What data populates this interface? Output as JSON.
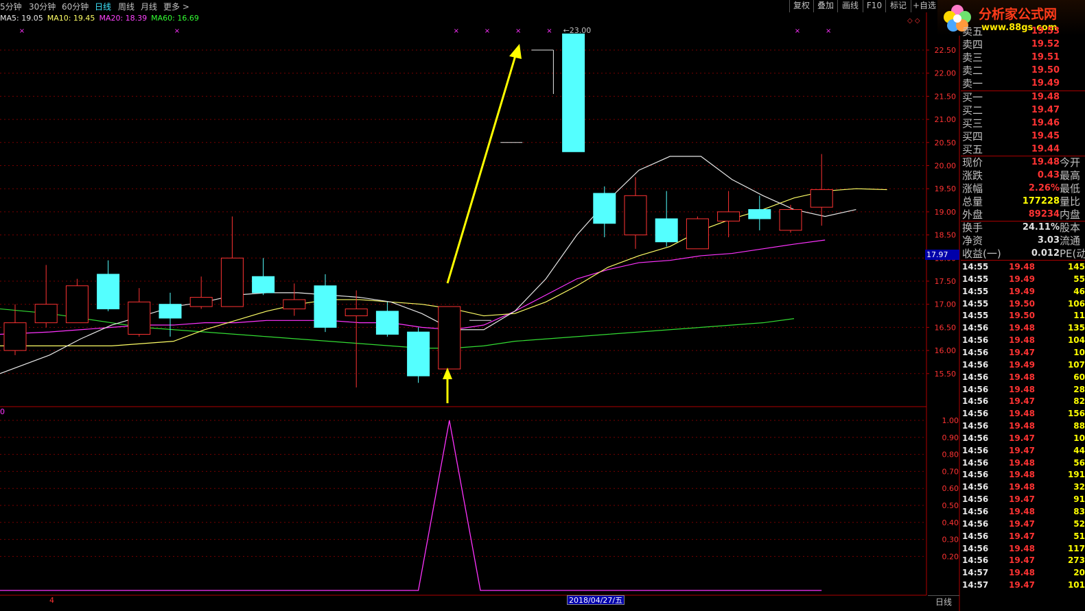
{
  "toolbar": {
    "periods": [
      {
        "label": "5分钟",
        "active": false
      },
      {
        "label": "30分钟",
        "active": false
      },
      {
        "label": "60分钟",
        "active": false
      },
      {
        "label": "日线",
        "active": true
      },
      {
        "label": "周线",
        "active": false
      },
      {
        "label": "月线",
        "active": false
      },
      {
        "label": "更多 >",
        "active": false
      }
    ],
    "buttons": [
      "复权",
      "叠加",
      "画线",
      "F10",
      "标记",
      "+自选"
    ]
  },
  "logo": {
    "title": "分析家公式网",
    "url": "www.88gs.com"
  },
  "ma_legend": [
    {
      "label": "MA5: 19.05",
      "color": "#e8e8e8"
    },
    {
      "label": "MA10: 19.45",
      "color": "#ffff66"
    },
    {
      "label": "MA20: 18.39",
      "color": "#ff44ff"
    },
    {
      "label": "MA60: 16.69",
      "color": "#33ff33"
    }
  ],
  "chart_data": {
    "type": "candlestick",
    "price_axis": {
      "min": 15.0,
      "max": 23.0,
      "ticks": [
        "22.50",
        "22.00",
        "21.50",
        "21.00",
        "20.50",
        "20.00",
        "19.50",
        "19.00",
        "18.50",
        "18.00",
        "17.50",
        "17.00",
        "16.50",
        "16.00",
        "15.50"
      ]
    },
    "indicator_axis": {
      "min": 0,
      "max": 1.0,
      "ticks": [
        "1.00",
        "0.90",
        "0.80",
        "0.70",
        "0.60",
        "0.50",
        "0.40",
        "0.30",
        "0.20"
      ]
    },
    "high_marker": "23.00",
    "current_price_tag": "17.97",
    "candles": [
      {
        "o": 16.0,
        "c": 16.6,
        "h": 17.0,
        "l": 15.9
      },
      {
        "o": 16.6,
        "c": 17.0,
        "h": 17.85,
        "l": 16.5
      },
      {
        "o": 16.6,
        "c": 17.4,
        "h": 17.55,
        "l": 16.6
      },
      {
        "o": 17.65,
        "c": 16.9,
        "h": 17.95,
        "l": 16.85
      },
      {
        "o": 16.35,
        "c": 17.05,
        "h": 17.35,
        "l": 16.3
      },
      {
        "o": 17.0,
        "c": 16.7,
        "h": 17.25,
        "l": 16.3
      },
      {
        "o": 16.95,
        "c": 17.15,
        "h": 17.6,
        "l": 16.9
      },
      {
        "o": 16.95,
        "c": 18.0,
        "h": 18.9,
        "l": 16.95
      },
      {
        "o": 17.6,
        "c": 17.25,
        "h": 18.0,
        "l": 17.2
      },
      {
        "o": 16.9,
        "c": 17.1,
        "h": 17.45,
        "l": 16.75
      },
      {
        "o": 17.4,
        "c": 16.5,
        "h": 17.65,
        "l": 16.4
      },
      {
        "o": 16.75,
        "c": 16.9,
        "h": 17.3,
        "l": 15.2
      },
      {
        "o": 16.85,
        "c": 16.35,
        "h": 17.05,
        "l": 16.3
      },
      {
        "o": 16.4,
        "c": 15.45,
        "h": 16.5,
        "l": 15.3
      },
      {
        "o": 15.6,
        "c": 16.95,
        "h": 16.95,
        "l": 15.6
      },
      {
        "o": 16.65,
        "c": 16.65,
        "h": 16.65,
        "l": 16.65,
        "doji": true
      },
      {
        "o": 20.5,
        "c": 20.5,
        "h": 20.5,
        "l": 20.5,
        "doji": true
      },
      {
        "o": 22.5,
        "c": 22.5,
        "h": 22.5,
        "l": 21.55,
        "doji": true
      },
      {
        "o": 22.85,
        "c": 20.3,
        "h": 22.85,
        "l": 20.3
      },
      {
        "o": 19.4,
        "c": 18.75,
        "h": 19.55,
        "l": 18.45
      },
      {
        "o": 18.5,
        "c": 19.35,
        "h": 19.75,
        "l": 18.2
      },
      {
        "o": 18.85,
        "c": 18.35,
        "h": 19.45,
        "l": 18.25
      },
      {
        "o": 18.2,
        "c": 18.85,
        "h": 18.9,
        "l": 18.2
      },
      {
        "o": 18.8,
        "c": 19.0,
        "h": 19.45,
        "l": 18.45
      },
      {
        "o": 19.05,
        "c": 18.85,
        "h": 19.35,
        "l": 18.6
      },
      {
        "o": 18.6,
        "c": 19.05,
        "h": 19.15,
        "l": 18.55
      },
      {
        "o": 19.1,
        "c": 19.48,
        "h": 20.25,
        "l": 18.7
      }
    ],
    "ma5": [
      15.5,
      15.9,
      16.25,
      16.55,
      16.75,
      16.95,
      17.05,
      17.2,
      17.25,
      17.25,
      17.2,
      17.15,
      17.05,
      16.8,
      16.45,
      16.45,
      16.85,
      17.55,
      18.5,
      19.25,
      19.9,
      20.2,
      20.2,
      19.7,
      19.35,
      19.05,
      18.9,
      19.05
    ],
    "ma10": [
      16.1,
      16.1,
      16.1,
      16.1,
      16.15,
      16.2,
      16.45,
      16.65,
      16.85,
      17.0,
      17.1,
      17.1,
      17.05,
      17.0,
      16.9,
      16.75,
      16.8,
      17.05,
      17.4,
      17.8,
      18.05,
      18.25,
      18.6,
      18.85,
      19.05,
      19.3,
      19.45,
      19.5,
      19.48
    ],
    "ma20": [
      16.35,
      16.4,
      16.45,
      16.5,
      16.55,
      16.55,
      16.6,
      16.6,
      16.65,
      16.65,
      16.65,
      16.6,
      16.6,
      16.5,
      16.45,
      16.55,
      16.85,
      17.2,
      17.55,
      17.75,
      17.9,
      17.95,
      18.05,
      18.1,
      18.2,
      18.3,
      18.39
    ],
    "ma60": [
      16.9,
      16.8,
      16.7,
      16.6,
      16.5,
      16.45,
      16.4,
      16.35,
      16.3,
      16.25,
      16.2,
      16.15,
      16.1,
      16.05,
      16.05,
      16.1,
      16.2,
      16.25,
      16.3,
      16.35,
      16.4,
      16.45,
      16.5,
      16.55,
      16.6,
      16.69
    ],
    "indicator": [
      0,
      0,
      0,
      0,
      0,
      0,
      0,
      0,
      0,
      0,
      0,
      0,
      0,
      0,
      1,
      0,
      0,
      0,
      0,
      0,
      0,
      0,
      0,
      0,
      0,
      0,
      0
    ],
    "x_marker_bars": [
      0,
      5,
      14,
      15,
      16,
      17,
      25,
      26
    ],
    "bottom_labels": {
      "left": "4",
      "date": "2018/04/27/五"
    }
  },
  "quote_panel": {
    "asks": [
      {
        "label": "卖五",
        "price": "19.53"
      },
      {
        "label": "卖四",
        "price": "19.52"
      },
      {
        "label": "卖三",
        "price": "19.51"
      },
      {
        "label": "卖二",
        "price": "19.50"
      },
      {
        "label": "卖一",
        "price": "19.49"
      }
    ],
    "bids": [
      {
        "label": "买一",
        "price": "19.48"
      },
      {
        "label": "买二",
        "price": "19.47"
      },
      {
        "label": "买三",
        "price": "19.46"
      },
      {
        "label": "买四",
        "price": "19.45"
      },
      {
        "label": "买五",
        "price": "19.44"
      }
    ],
    "stats1": [
      {
        "label": "现价",
        "value": "19.48",
        "extra": "今开",
        "cls": ""
      },
      {
        "label": "涨跌",
        "value": "0.43",
        "extra": "最高",
        "cls": ""
      },
      {
        "label": "涨幅",
        "value": "2.26%",
        "extra": "最低",
        "cls": ""
      },
      {
        "label": "总量",
        "value": "177228",
        "extra": "量比",
        "cls": "yellow"
      },
      {
        "label": "外盘",
        "value": "89234",
        "extra": "内盘",
        "cls": ""
      }
    ],
    "stats2": [
      {
        "label": "换手",
        "value": "24.11%",
        "extra": "股本",
        "cls": "white"
      },
      {
        "label": "净资",
        "value": "3.03",
        "extra": "流通",
        "cls": "white"
      },
      {
        "label": "收益(一)",
        "value": "0.012",
        "extra": "PE(动)",
        "cls": "white"
      }
    ],
    "ticks": [
      {
        "t": "14:55",
        "p": "19.48",
        "v": "145"
      },
      {
        "t": "14:55",
        "p": "19.49",
        "v": "55"
      },
      {
        "t": "14:55",
        "p": "19.49",
        "v": "46"
      },
      {
        "t": "14:55",
        "p": "19.50",
        "v": "106"
      },
      {
        "t": "14:55",
        "p": "19.50",
        "v": "11"
      },
      {
        "t": "14:56",
        "p": "19.48",
        "v": "135"
      },
      {
        "t": "14:56",
        "p": "19.48",
        "v": "104"
      },
      {
        "t": "14:56",
        "p": "19.47",
        "v": "10"
      },
      {
        "t": "14:56",
        "p": "19.49",
        "v": "107"
      },
      {
        "t": "14:56",
        "p": "19.48",
        "v": "60"
      },
      {
        "t": "14:56",
        "p": "19.48",
        "v": "28"
      },
      {
        "t": "14:56",
        "p": "19.47",
        "v": "82"
      },
      {
        "t": "14:56",
        "p": "19.48",
        "v": "156"
      },
      {
        "t": "14:56",
        "p": "19.48",
        "v": "88"
      },
      {
        "t": "14:56",
        "p": "19.47",
        "v": "10"
      },
      {
        "t": "14:56",
        "p": "19.47",
        "v": "44"
      },
      {
        "t": "14:56",
        "p": "19.48",
        "v": "56"
      },
      {
        "t": "14:56",
        "p": "19.48",
        "v": "191"
      },
      {
        "t": "14:56",
        "p": "19.48",
        "v": "32"
      },
      {
        "t": "14:56",
        "p": "19.47",
        "v": "91"
      },
      {
        "t": "14:56",
        "p": "19.48",
        "v": "83"
      },
      {
        "t": "14:56",
        "p": "19.47",
        "v": "52"
      },
      {
        "t": "14:56",
        "p": "19.47",
        "v": "51"
      },
      {
        "t": "14:56",
        "p": "19.48",
        "v": "117"
      },
      {
        "t": "14:56",
        "p": "19.47",
        "v": "273"
      },
      {
        "t": "14:57",
        "p": "19.48",
        "v": "20"
      },
      {
        "t": "14:57",
        "p": "19.47",
        "v": "101"
      }
    ]
  },
  "bottom_tab": "日线",
  "colors": {
    "up": "#ff3333",
    "down": "#54ffff",
    "grid": "#7a0000",
    "arrow": "#ffff00",
    "indicator_line": "#ff33ff"
  }
}
